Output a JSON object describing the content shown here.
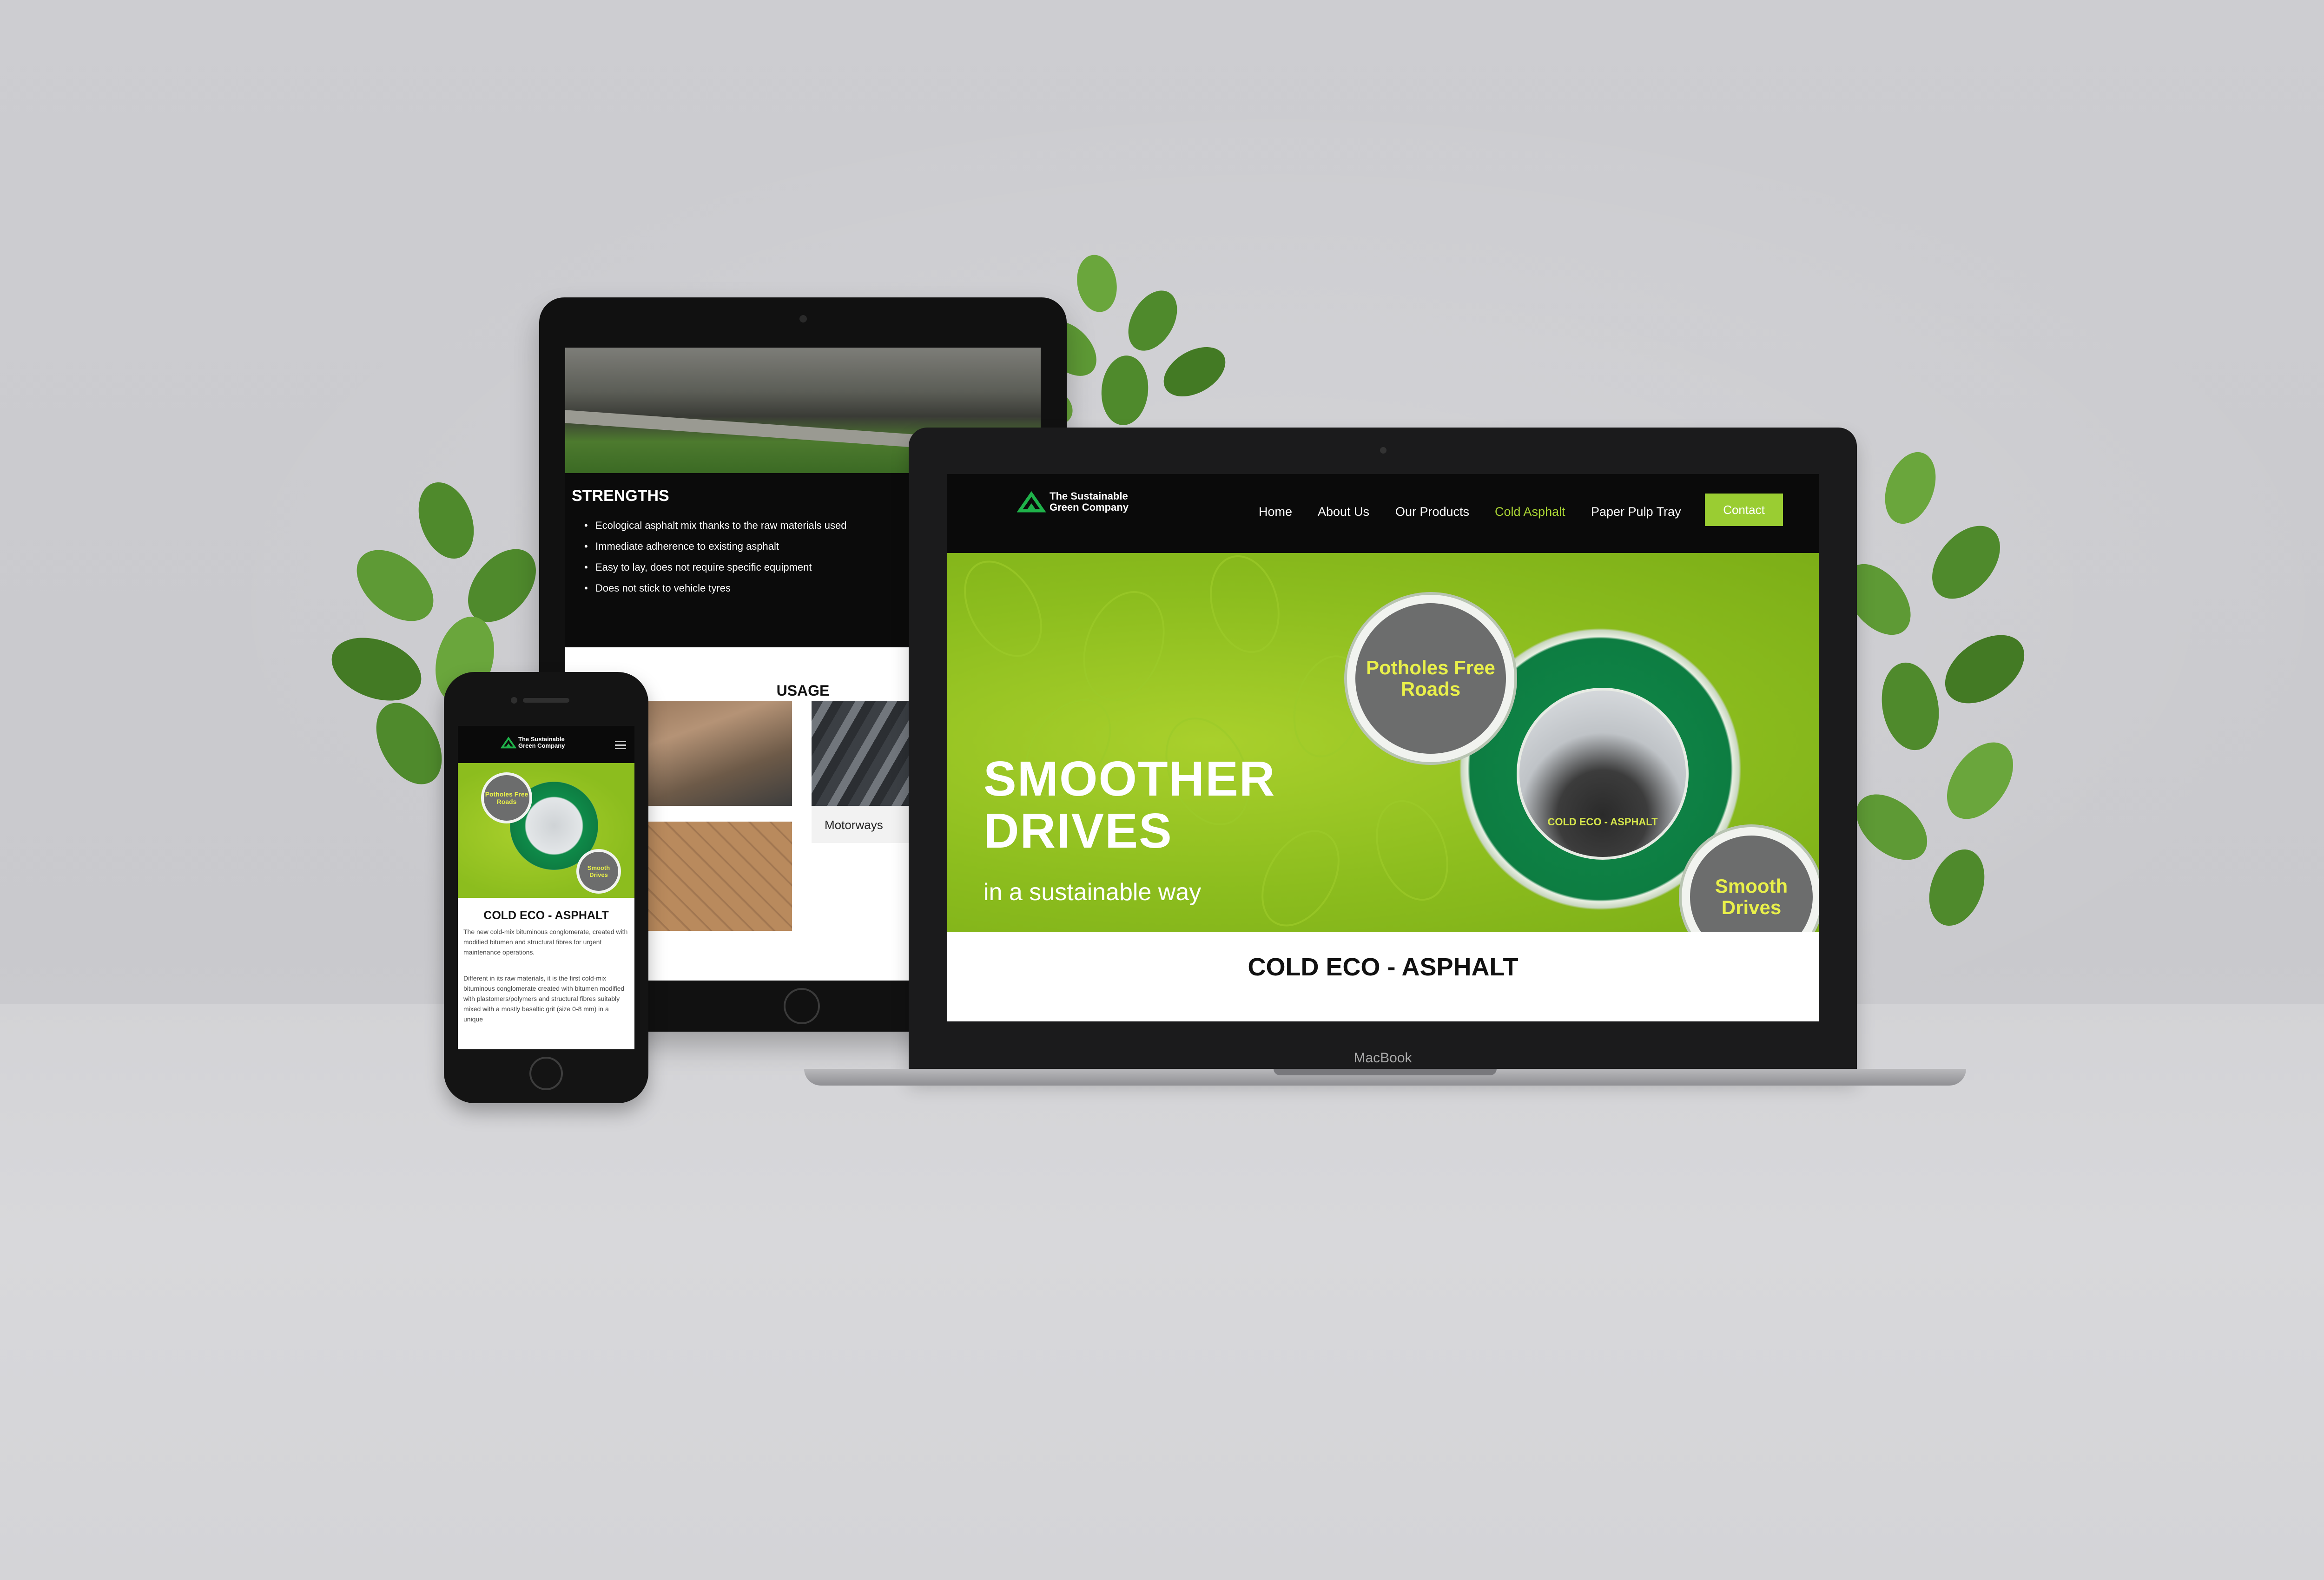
{
  "brand": {
    "name_line1": "The Sustainable",
    "name_line2": "Green Company",
    "accent": "#9acd32",
    "dark": "#0a0a0a"
  },
  "laptop": {
    "device_label": "MacBook",
    "nav": {
      "items": [
        "Home",
        "About Us",
        "Our Products",
        "Cold Asphalt",
        "Paper Pulp Tray"
      ],
      "active": "Cold Asphalt",
      "contact_label": "Contact"
    },
    "hero": {
      "title_line1": "SMOOTHER",
      "title_line2": "DRIVES",
      "subtitle": "in a sustainable way",
      "bubble_left": "Potholes Free Roads",
      "bubble_right": "Smooth Drives",
      "product_label": "COLD ECO - ASPHALT"
    },
    "section_title": "COLD ECO - ASPHALT"
  },
  "tablet": {
    "strengths_title": "STRENGTHS",
    "strengths": [
      "Ecological asphalt mix thanks to the raw materials used",
      "Immediate adherence to existing asphalt",
      "Easy to lay, does not require specific equipment",
      "Does not stick to vehicle tyres"
    ],
    "usage_title": "USAGE",
    "usage_card_label": "Motorways"
  },
  "phone": {
    "bubble_left": "Potholes Free Roads",
    "bubble_right": "Smooth Drives",
    "section_title": "COLD ECO - ASPHALT",
    "para1": "The new cold-mix bituminous conglomerate, created with modified bitumen and structural fibres for urgent maintenance operations.",
    "para2": "Different in its raw materials, it is the first cold-mix bituminous conglomerate created with bitumen modified with plastomers/polymers and structural fibres suitably mixed with a mostly basaltic grit (size 0-8 mm) in a unique"
  }
}
